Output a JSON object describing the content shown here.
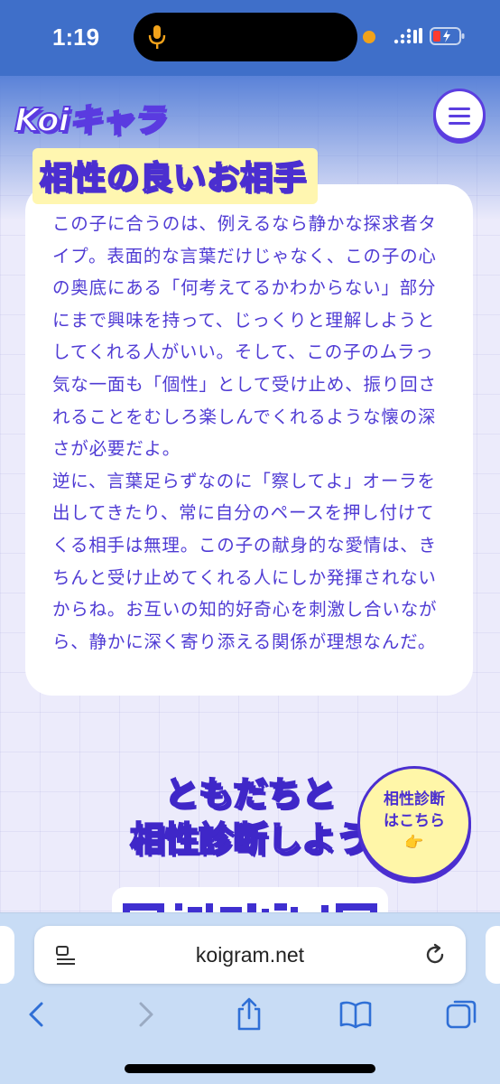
{
  "status_bar": {
    "time": "1:19"
  },
  "header": {
    "logo_text": "Koiキャラ"
  },
  "section": {
    "title": "相性の良いお相手",
    "paragraphs": [
      "この子に合うのは、例えるなら静かな探求者タイプ。表面的な言葉だけじゃなく、この子の心の奥底にある「何考えてるかわからない」部分にまで興味を持って、じっくりと理解しようとしてくれる人がいい。そして、この子のムラっ気な一面も「個性」として受け止め、振り回されることをむしろ楽しんでくれるような懐の深さが必要だよ。",
      "逆に、言葉足らずなのに「察してよ」オーラを出してきたり、常に自分のペースを押し付けてくる相手は無理。この子の献身的な愛情は、きちんと受け止めてくれる人にしか発揮されないからね。お互いの知的好奇心を刺激し合いながら、静かに深く寄り添える関係が理想なんだ。"
    ]
  },
  "friends": {
    "title_line1": "ともだちと",
    "title_line2": "相性診断しよう",
    "cta_line1": "相性診断",
    "cta_line2": "はこちら",
    "cta_emoji": "👉"
  },
  "browser": {
    "url": "koigram.net"
  },
  "colors": {
    "accent": "#4f3bd4",
    "status_bar": "#3f6fc9",
    "toolbar": "#c8dcf5",
    "highlight": "#fff6b0"
  }
}
